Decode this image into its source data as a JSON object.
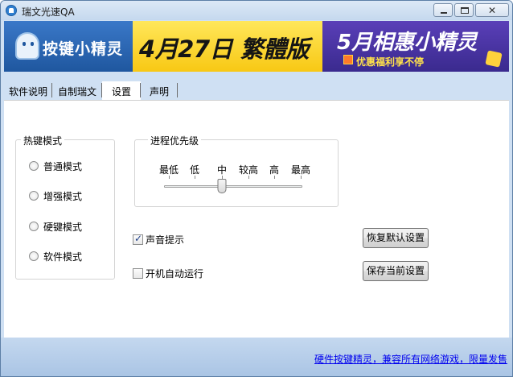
{
  "window": {
    "title": "瑞文光速QA"
  },
  "banner": {
    "logo_text": "按键小精灵",
    "promo1_text": "4月27日 繁體版",
    "promo2_title": "5月相惠小精灵",
    "promo2_sub": "优惠福利享不停"
  },
  "tabs": [
    {
      "label": "软件说明",
      "active": false
    },
    {
      "label": "自制瑞文",
      "active": false
    },
    {
      "label": "设置",
      "active": true
    },
    {
      "label": "声明",
      "active": false
    }
  ],
  "hotkey_group": {
    "title": "热键模式",
    "options": [
      {
        "label": "普通模式",
        "selected": false
      },
      {
        "label": "增强模式",
        "selected": false
      },
      {
        "label": "硬键模式",
        "selected": false
      },
      {
        "label": "软件模式",
        "selected": false
      }
    ]
  },
  "priority_group": {
    "title": "进程优先级",
    "levels": [
      "最低",
      "低",
      "中",
      "较高",
      "高",
      "最高"
    ],
    "selected_level": "中"
  },
  "options": {
    "sound_label": "声音提示",
    "sound_checked": true,
    "autostart_label": "开机自动运行",
    "autostart_checked": false
  },
  "buttons": {
    "restore_default": "恢复默认设置",
    "save_current": "保存当前设置"
  },
  "footer": {
    "link_text": "硬件按键精灵，兼容所有网络游戏，限量发售"
  },
  "colors": {
    "title_bar": "#c5d8ee",
    "banner_blue": "#1b4e9a",
    "promo_yellow": "#f8c814",
    "promo_purple": "#3a2a8e",
    "link": "#0000ee"
  }
}
